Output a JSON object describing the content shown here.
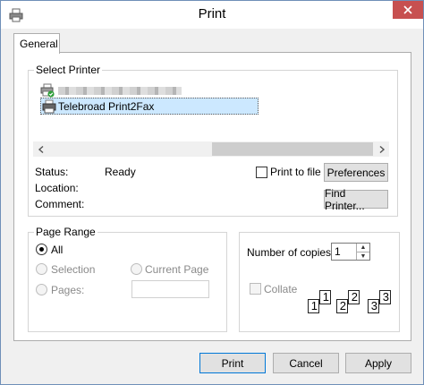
{
  "window": {
    "title": "Print"
  },
  "tabs": [
    {
      "label": "General",
      "active": true
    }
  ],
  "select_printer": {
    "group_title": "Select Printer",
    "printers": [
      {
        "label": "",
        "obscured": true
      },
      {
        "label": "Telebroad Print2Fax",
        "selected": true
      }
    ]
  },
  "status": {
    "status_label": "Status:",
    "status_value": "Ready",
    "location_label": "Location:",
    "location_value": "",
    "comment_label": "Comment:",
    "comment_value": ""
  },
  "print_to_file": {
    "label": "Print to file",
    "checked": false
  },
  "buttons": {
    "preferences": "Preferences",
    "find_printer": "Find Printer...",
    "print": "Print",
    "cancel": "Cancel",
    "apply": "Apply"
  },
  "page_range": {
    "group_title": "Page Range",
    "all": "All",
    "selection": "Selection",
    "current_page": "Current Page",
    "pages": "Pages:",
    "selected_option": "All",
    "pages_value": ""
  },
  "copies": {
    "label": "Number of copies:",
    "value": "1",
    "collate_label": "Collate",
    "collate_checked": false,
    "collate_pages": [
      [
        "1",
        "1"
      ],
      [
        "2",
        "2"
      ],
      [
        "3",
        "3"
      ]
    ]
  },
  "icons": {
    "app": "printer-icon",
    "close": "close-icon",
    "printer": "printer-icon",
    "default_printer_badge": "check-badge-icon",
    "scroll_left": "chevron-left-icon",
    "scroll_right": "chevron-right-icon",
    "spin_up": "spin-up-icon",
    "spin_down": "spin-down-icon"
  },
  "colors": {
    "close_button": "#c75050",
    "selection_highlight": "#cce8ff",
    "default_button_border": "#0078d7",
    "window_border": "#6f8fb8"
  }
}
